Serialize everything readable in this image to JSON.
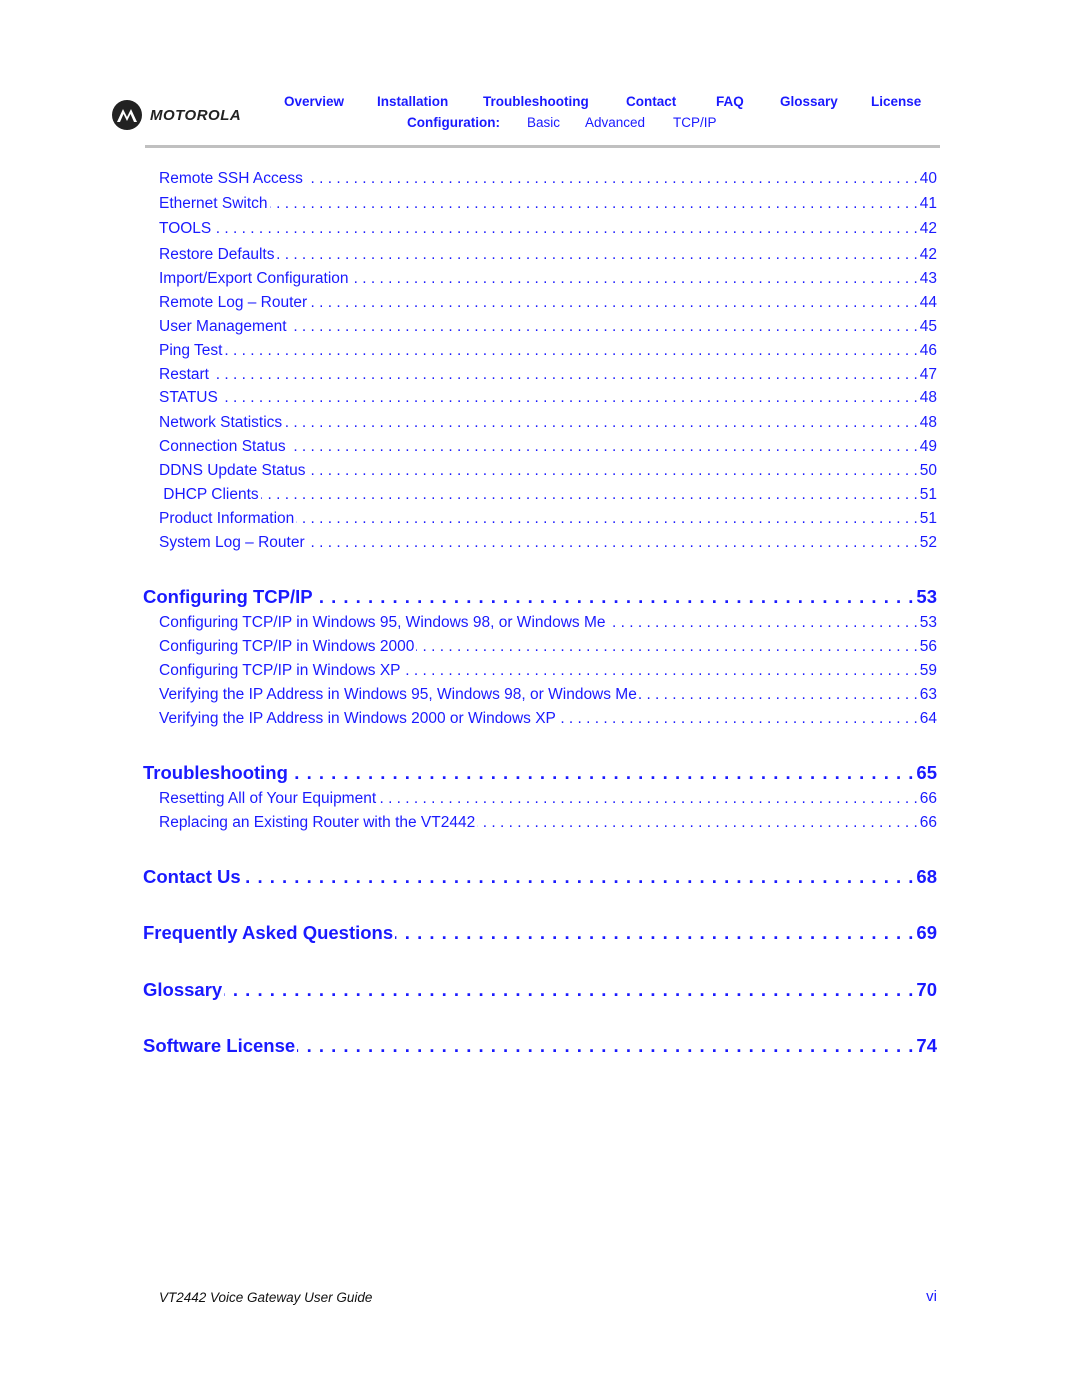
{
  "header": {
    "logo_text": "MOTOROLA",
    "nav": [
      "Overview",
      "Installation",
      "Troubleshooting",
      "Contact",
      "FAQ",
      "Glossary",
      "License"
    ],
    "config_label": "Configuration:",
    "config_links": [
      "Basic",
      "Advanced",
      "TCP/IP"
    ]
  },
  "toc": [
    {
      "level": "sub",
      "label": "Remote SSH Access",
      "page": "40"
    },
    {
      "level": "sub",
      "label": "Ethernet Switch",
      "page": "41"
    },
    {
      "level": "sub",
      "label": "TOOLS",
      "page": "42"
    },
    {
      "level": "sub",
      "label": "Restore Defaults",
      "page": "42"
    },
    {
      "level": "sub",
      "label": "Import/Export Configuration",
      "page": "43"
    },
    {
      "level": "sub",
      "label": "Remote Log – Router",
      "page": "44"
    },
    {
      "level": "sub",
      "label": "User Management",
      "page": "45"
    },
    {
      "level": "sub",
      "label": "Ping Test",
      "page": "46"
    },
    {
      "level": "sub",
      "label": "Restart",
      "page": "47"
    },
    {
      "level": "sub",
      "label": "STATUS",
      "page": "48"
    },
    {
      "level": "sub",
      "label": "Network Statistics",
      "page": "48"
    },
    {
      "level": "sub",
      "label": "Connection Status",
      "page": "49"
    },
    {
      "level": "sub",
      "label": "DDNS Update Status",
      "page": "50"
    },
    {
      "level": "sub",
      "label": " DHCP Clients",
      "page": "51"
    },
    {
      "level": "sub",
      "label": "Product Information",
      "page": "51"
    },
    {
      "level": "sub",
      "label": "System Log – Router",
      "page": "52"
    },
    {
      "level": "chap",
      "label": "Configuring TCP/IP",
      "page": "53"
    },
    {
      "level": "sub",
      "label": "Configuring TCP/IP in Windows 95, Windows 98, or Windows Me",
      "page": "53"
    },
    {
      "level": "sub",
      "label": "Configuring TCP/IP in Windows 2000",
      "page": "56"
    },
    {
      "level": "sub",
      "label": "Configuring TCP/IP in Windows XP",
      "page": "59"
    },
    {
      "level": "sub",
      "label": "Verifying the IP Address in Windows 95, Windows 98, or Windows Me",
      "page": "63"
    },
    {
      "level": "sub",
      "label": "Verifying the IP Address in Windows 2000 or Windows XP",
      "page": "64"
    },
    {
      "level": "chap",
      "label": "Troubleshooting",
      "page": "65"
    },
    {
      "level": "sub",
      "label": "Resetting All of Your Equipment",
      "page": "66"
    },
    {
      "level": "sub",
      "label": "Replacing an Existing Router with the VT2442",
      "page": "66"
    },
    {
      "level": "chap",
      "label": "Contact Us",
      "page": "68"
    },
    {
      "level": "chap",
      "label": "Frequently Asked Questions",
      "page": "69"
    },
    {
      "level": "chap",
      "label": "Glossary",
      "page": "70"
    },
    {
      "level": "chap",
      "label": "Software License",
      "page": "74"
    }
  ],
  "footer": {
    "title": "VT2442 Voice Gateway User Guide",
    "page": "vi"
  },
  "colors": {
    "link": "#1a1aff",
    "rule": "#c0c0c0",
    "logo": "#222222"
  }
}
